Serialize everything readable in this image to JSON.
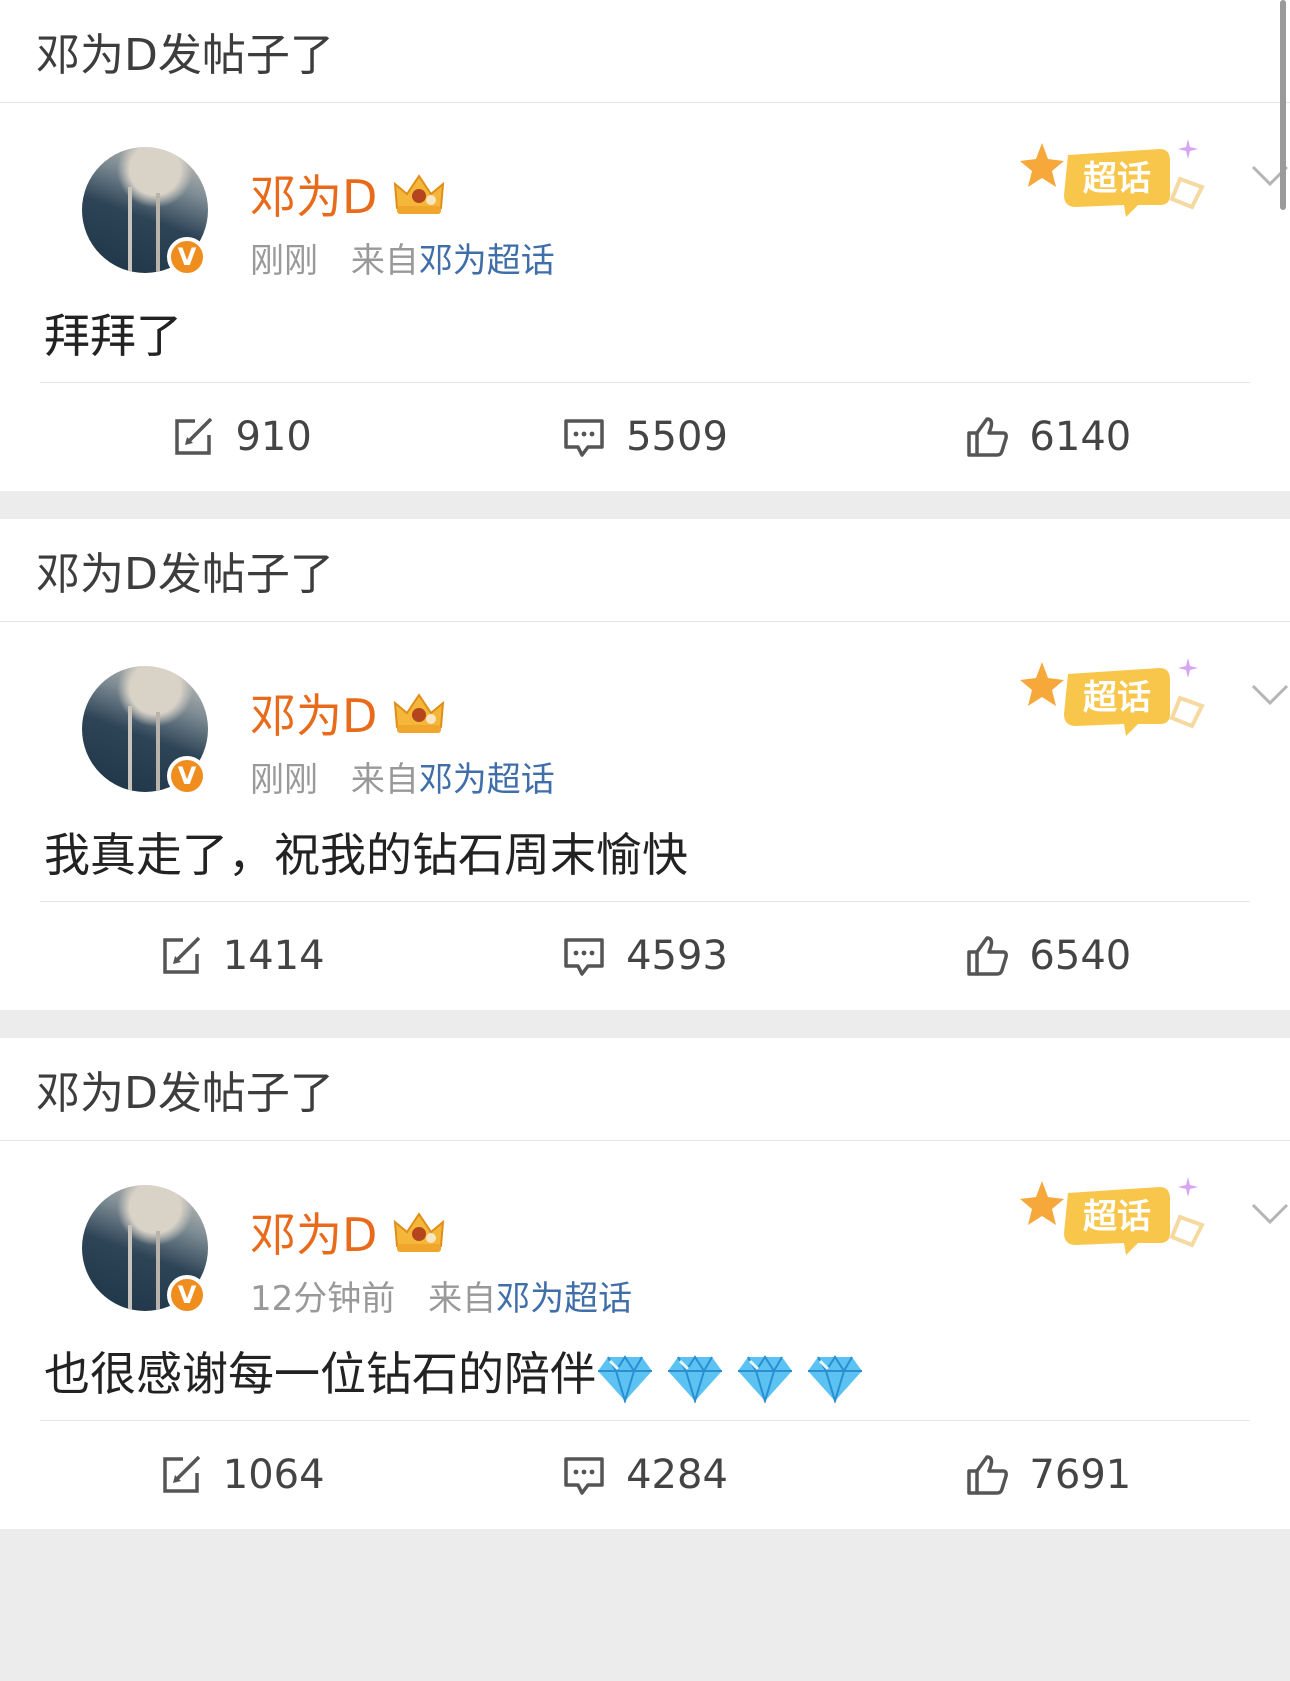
{
  "posts": [
    {
      "header": "邓为D发帖子了",
      "username": "邓为D",
      "time": "刚刚",
      "from": "来自",
      "topic": "邓为超话",
      "badge": "超话",
      "content": "拜拜了",
      "gems": 0,
      "reposts": "910",
      "comments": "5509",
      "likes": "6140"
    },
    {
      "header": "邓为D发帖子了",
      "username": "邓为D",
      "time": "刚刚",
      "from": "来自",
      "topic": "邓为超话",
      "badge": "超话",
      "content": "我真走了，祝我的钻石周末愉快",
      "gems": 0,
      "reposts": "1414",
      "comments": "4593",
      "likes": "6540"
    },
    {
      "header": "邓为D发帖子了",
      "username": "邓为D",
      "time": "12分钟前",
      "from": "来自",
      "topic": "邓为超话",
      "badge": "超话",
      "content": "也很感谢每一位钻石的陪伴",
      "gems": 4,
      "reposts": "1064",
      "comments": "4284",
      "likes": "7691"
    }
  ],
  "icons": {
    "verified": "V",
    "crown": "crown-icon",
    "gem": "diamond-emoji-icon"
  },
  "colors": {
    "username": "#e86b1c",
    "topic_link": "#3f6ea8",
    "verified_badge": "#f08d1f",
    "super_topic_badge": "#f7c64a"
  }
}
